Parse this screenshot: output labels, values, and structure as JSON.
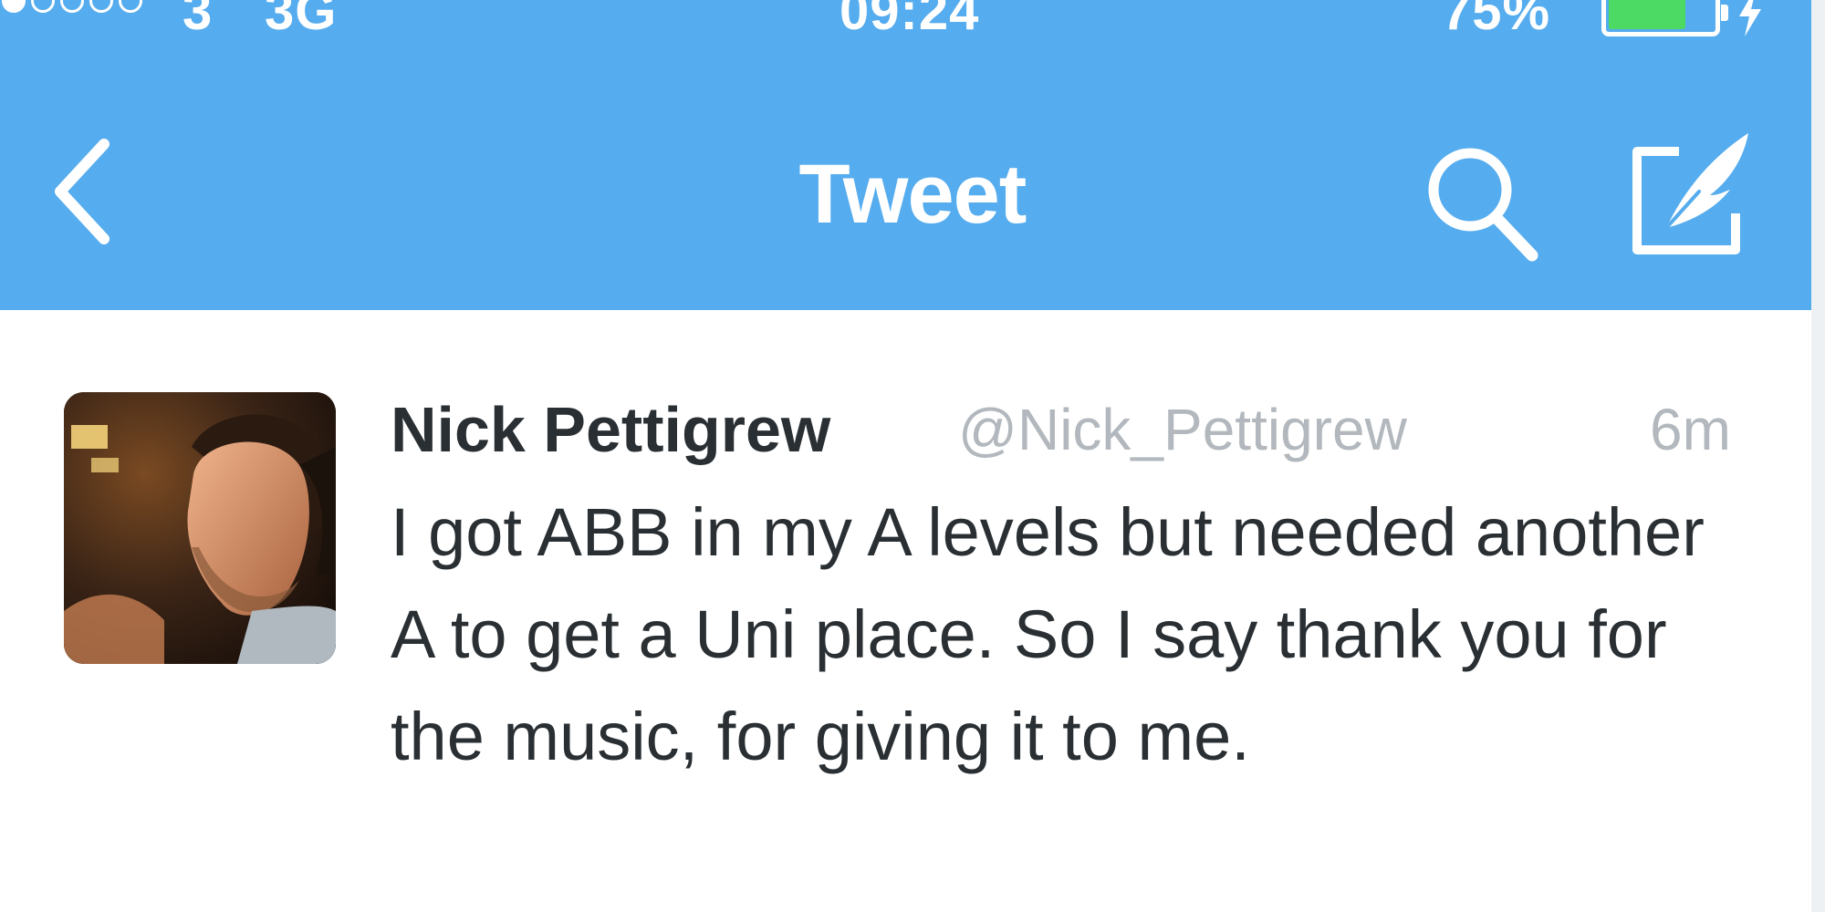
{
  "status_bar": {
    "carrier": "3",
    "network": "3G",
    "time": "09:24",
    "battery_percent": "75%",
    "battery_level": 0.75,
    "signal_bars_filled": 1,
    "signal_bars_total": 5
  },
  "nav_bar": {
    "title": "Tweet",
    "back_icon": "chevron-left-icon",
    "search_icon": "search-icon",
    "compose_icon": "compose-icon"
  },
  "tweet": {
    "user_name": "Nick Pettigrew",
    "user_handle": "@Nick_Pettigrew",
    "timestamp": "6m",
    "text": "I got ABB in my A levels but needed another A to get a Uni place. So I say thank you for the music, for giving it to me."
  },
  "colors": {
    "header_blue": "#55acee",
    "battery_green": "#4cd964",
    "text_dark": "#292f33",
    "text_muted": "#b2b8bd"
  }
}
